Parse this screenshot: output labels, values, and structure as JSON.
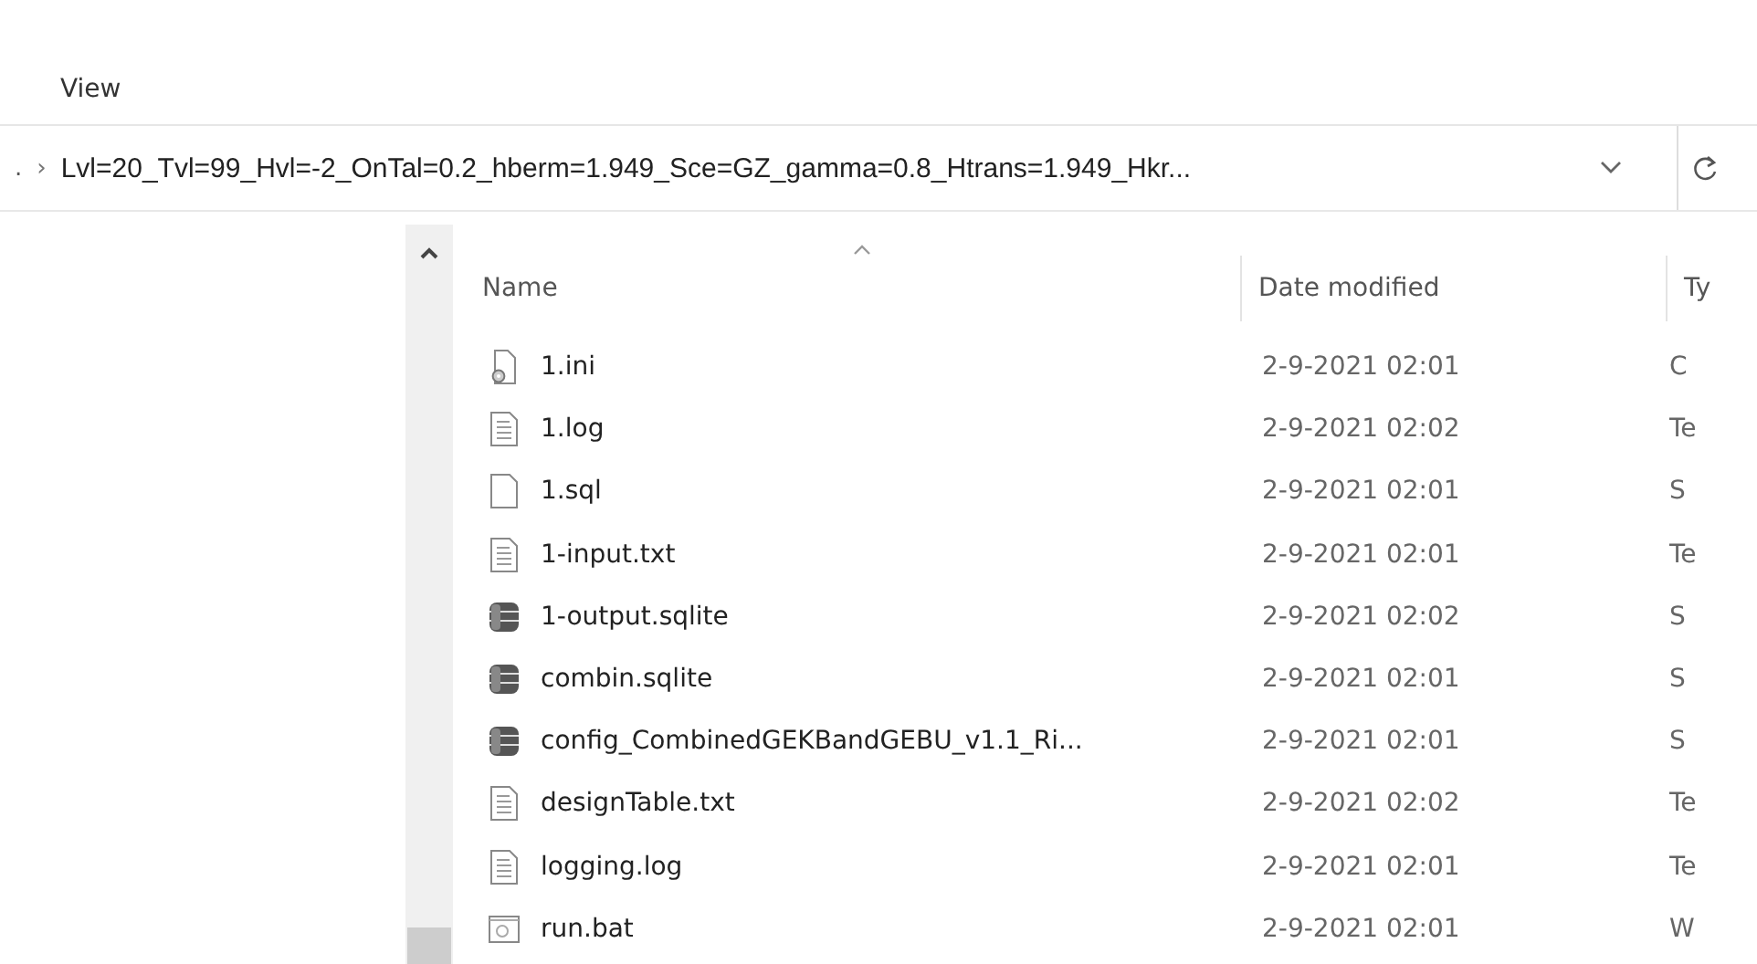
{
  "menu": [
    {
      "label": "View"
    }
  ],
  "address": {
    "prefix": ".",
    "separator": "›",
    "path": "Lvl=20_Tvl=99_Hvl=-2_OnTal=0.2_hberm=1.949_Sce=GZ_gamma=0.8_Htrans=1.949_Hkr..."
  },
  "columns": [
    {
      "label": "Name",
      "sorted": true
    },
    {
      "label": "Date modified",
      "sorted": false
    },
    {
      "label": "Ty",
      "sorted": false
    }
  ],
  "rows": [
    {
      "kind": "config",
      "name": "1.ini",
      "date": "2-9-2021 02:01",
      "type": "C"
    },
    {
      "kind": "text",
      "name": "1.log",
      "date": "2-9-2021 02:02",
      "type": "Te"
    },
    {
      "kind": "blank",
      "name": "1.sql",
      "date": "2-9-2021 02:01",
      "type": "S"
    },
    {
      "kind": "text",
      "name": "1-input.txt",
      "date": "2-9-2021 02:01",
      "type": "Te"
    },
    {
      "kind": "database",
      "name": "1-output.sqlite",
      "date": "2-9-2021 02:02",
      "type": "S"
    },
    {
      "kind": "database",
      "name": "combin.sqlite",
      "date": "2-9-2021 02:01",
      "type": "S"
    },
    {
      "kind": "database",
      "name": "config_CombinedGEKBandGEBU_v1.1_Ri...",
      "date": "2-9-2021 02:01",
      "type": "S"
    },
    {
      "kind": "text",
      "name": "designTable.txt",
      "date": "2-9-2021 02:02",
      "type": "Te"
    },
    {
      "kind": "text",
      "name": "logging.log",
      "date": "2-9-2021 02:01",
      "type": "Te"
    },
    {
      "kind": "batch",
      "name": "run.bat",
      "date": "2-9-2021 02:01",
      "type": "W"
    }
  ]
}
